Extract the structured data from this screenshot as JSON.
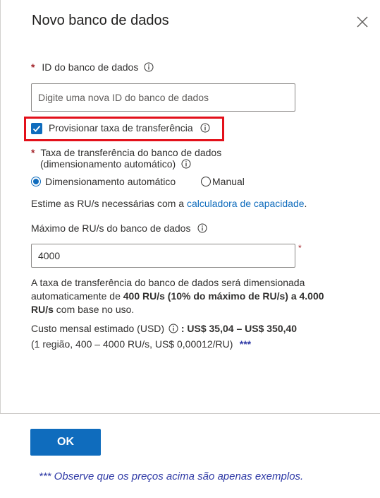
{
  "dialog": {
    "title": "Novo banco de dados",
    "close_icon": "close-icon"
  },
  "database_id": {
    "required_mark": "*",
    "label": "ID do banco de dados",
    "placeholder": "Digite uma nova ID do banco de dados",
    "value": ""
  },
  "provision_throughput": {
    "checked": true,
    "label": "Provisionar taxa de transferência"
  },
  "throughput": {
    "required_mark": "*",
    "label_line1": "Taxa de transferência do banco de dados",
    "label_line2": "(dimensionamento automático)",
    "options": [
      {
        "label": "Dimensionamento automático",
        "selected": true
      },
      {
        "label": "Manual",
        "selected": false
      }
    ]
  },
  "estimate": {
    "text": "Estime as RU/s necessárias com a ",
    "link": "calculadora de capacidade",
    "suffix": "."
  },
  "max_ru": {
    "label": "Máximo de RU/s do banco de dados",
    "value": "4000",
    "required_mark": "*"
  },
  "description": {
    "part1": "A taxa de transferência do banco de dados será dimensionada",
    "part2": "automaticamente de ",
    "bold": "400 RU/s (10% do máximo de RU/s) a 4.000",
    "bold2": "RU/s",
    "part3": " com base no uso."
  },
  "cost": {
    "label": "Custo mensal estimado (USD)",
    "value": ": US$ 35,04 – US$ 350,40",
    "detail": "(1 região, 400 – 4000 RU/s, US$ 0,00012/RU)",
    "stars": "***"
  },
  "ok_button": {
    "label": "OK"
  },
  "footnote": "*** Observe que os preços acima são apenas exemplos.",
  "colors": {
    "accent": "#0f6cbd",
    "highlight": "#e3101a",
    "required": "#a4262c",
    "note": "#2f3aa6"
  }
}
